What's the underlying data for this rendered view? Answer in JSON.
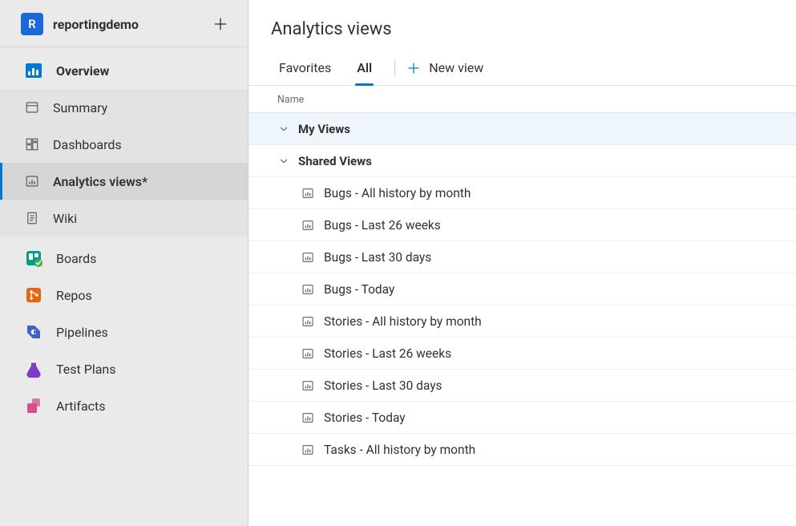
{
  "project": {
    "avatar_letter": "R",
    "name": "reportingdemo"
  },
  "sidebar": {
    "group_label": "Overview",
    "sub_items": [
      {
        "label": "Summary",
        "selected": false
      },
      {
        "label": "Dashboards",
        "selected": false
      },
      {
        "label": "Analytics views*",
        "selected": true
      },
      {
        "label": "Wiki",
        "selected": false
      }
    ],
    "sections": [
      {
        "label": "Boards",
        "icon": "boards-icon",
        "color": "ic-teal"
      },
      {
        "label": "Repos",
        "icon": "repos-icon",
        "color": "ic-orange"
      },
      {
        "label": "Pipelines",
        "icon": "pipelines-icon",
        "color": "ic-indigo"
      },
      {
        "label": "Test Plans",
        "icon": "test-plans-icon",
        "color": "ic-purple"
      },
      {
        "label": "Artifacts",
        "icon": "artifacts-icon",
        "color": "ic-pink"
      }
    ]
  },
  "main": {
    "title": "Analytics views",
    "tabs": [
      {
        "label": "Favorites",
        "active": false
      },
      {
        "label": "All",
        "active": true
      }
    ],
    "new_view_label": "New view",
    "column_header": "Name",
    "groups": [
      {
        "label": "My Views",
        "highlight": true,
        "items": []
      },
      {
        "label": "Shared Views",
        "highlight": false,
        "items": [
          "Bugs - All history by month",
          "Bugs - Last 26 weeks",
          "Bugs - Last 30 days",
          "Bugs - Today",
          "Stories - All history by month",
          "Stories - Last 26 weeks",
          "Stories - Last 30 days",
          "Stories - Today",
          "Tasks - All history by month"
        ]
      }
    ]
  }
}
